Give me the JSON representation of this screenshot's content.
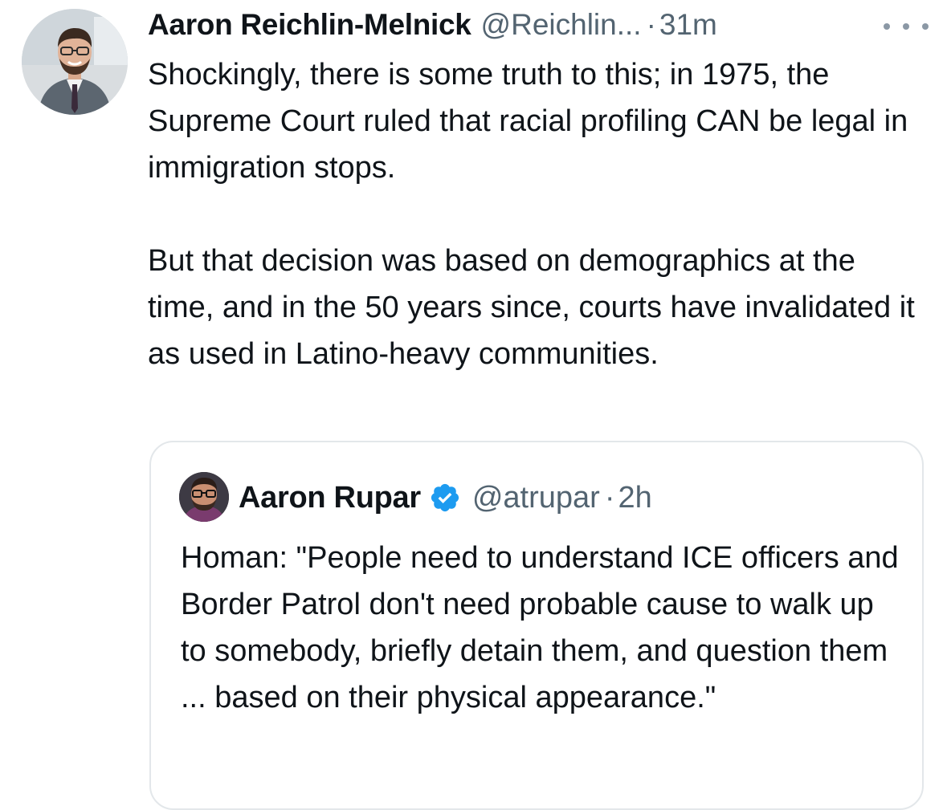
{
  "tweet": {
    "author": {
      "display_name": "Aaron Reichlin-Melnick",
      "handle": "@Reichlin...",
      "avatar_icon": "profile-photo-man-in-suit"
    },
    "separator": "·",
    "timestamp": "31m",
    "more_icon": "more-options-icon",
    "paragraphs": [
      "Shockingly, there is some truth to this; in 1975, the Supreme Court ruled that racial profiling CAN be legal in immigration stops.",
      "But that decision was based on demographics at the time, and in the 50 years since, courts have invalidated it as used in Latino-heavy communities."
    ]
  },
  "quote": {
    "author": {
      "display_name": "Aaron Rupar",
      "handle": "@atrupar",
      "verified": true,
      "verified_color": "#1d9bf0",
      "avatar_icon": "profile-photo-man-with-glasses"
    },
    "separator": "·",
    "timestamp": "2h",
    "text": "Homan: \"People need to understand ICE officers and Border Patrol don't need probable cause to walk up to somebody, briefly detain them, and question them ... based on their physical appearance.\""
  },
  "colors": {
    "text_primary": "#0f1419",
    "text_secondary": "#536471",
    "border": "#e3e7ea",
    "accent": "#1d9bf0"
  }
}
